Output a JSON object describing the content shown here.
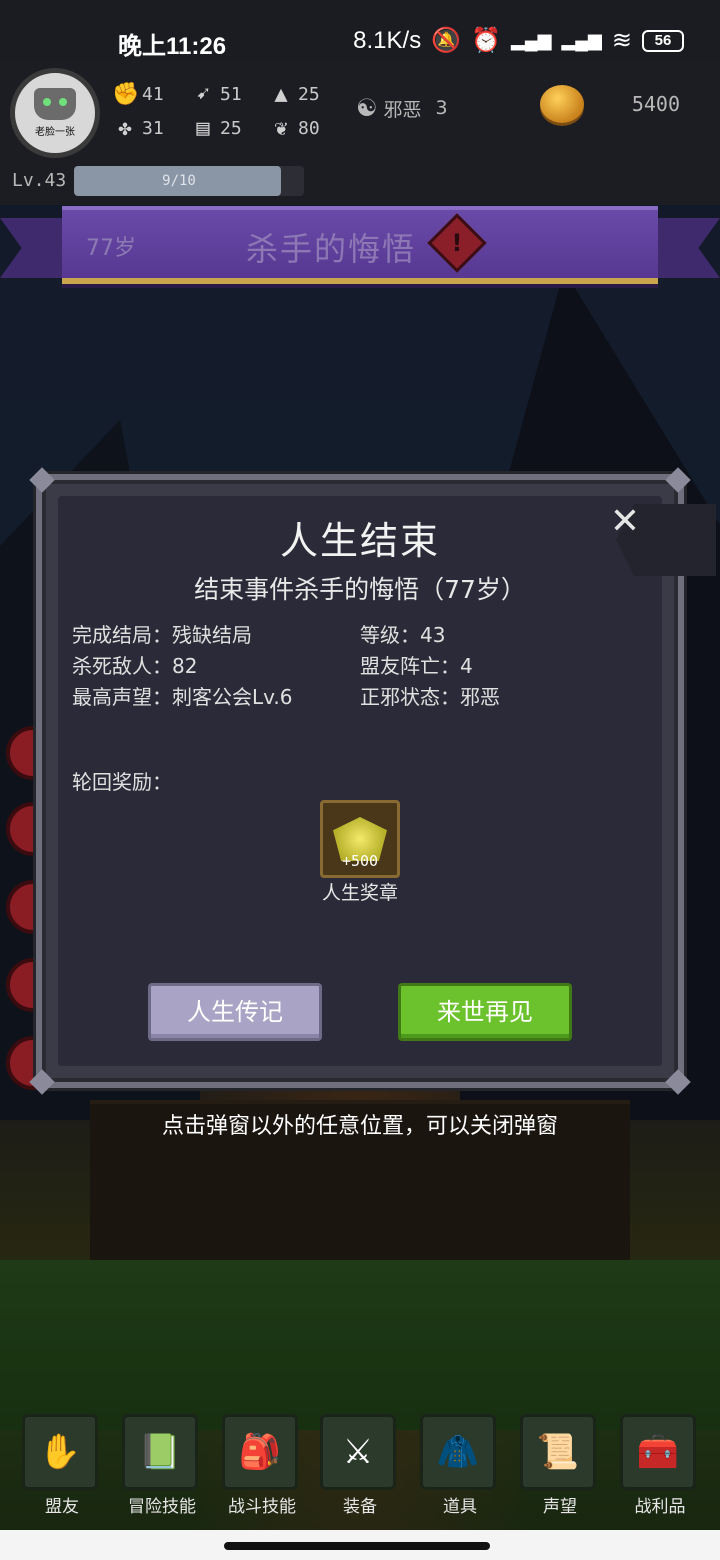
{
  "status_bar": {
    "time": "晚上11:26",
    "speed": "8.1K/s",
    "battery": "56"
  },
  "hud": {
    "avatar_name": "老脸一张",
    "stats": [
      {
        "icon": "fist-icon",
        "glyph": "✊",
        "value": "41"
      },
      {
        "icon": "clover-icon",
        "glyph": "✤",
        "value": "31"
      },
      {
        "icon": "gesture-icon",
        "glyph": "➹",
        "value": "51"
      },
      {
        "icon": "book-icon",
        "glyph": "▤",
        "value": "25"
      },
      {
        "icon": "wizard-hat-icon",
        "glyph": "▲",
        "value": "25"
      },
      {
        "icon": "lotus-icon",
        "glyph": "❦",
        "value": "80"
      }
    ],
    "alignment": {
      "icon": "yin-yang-icon",
      "glyph": "☯",
      "label": "邪恶",
      "value": "3"
    },
    "gold": "5400",
    "level": "Lv.43",
    "xp_text": "9/10",
    "xp_fraction": 0.9
  },
  "banner": {
    "age": "77岁",
    "title": "杀手的悔悟",
    "alert": "!"
  },
  "modal": {
    "title": "人生结束",
    "close": "✕",
    "event": "结束事件杀手的悔悟（77岁）",
    "info_left": [
      "完成结局：残缺结局",
      "杀死敌人：82",
      "最高声望：刺客公会Lv.6"
    ],
    "info_right": [
      "等级：43",
      "盟友阵亡：4",
      "正邪状态：邪恶"
    ],
    "reward_label": "轮回奖励：",
    "reward": {
      "count": "+500",
      "name": "人生奖章"
    },
    "btn_story": "人生传记",
    "btn_next": "来世再见"
  },
  "hint": "点击弹窗以外的任意位置，可以关闭弹窗",
  "bottom_nav": [
    {
      "label": "盟友",
      "glyph": "✋"
    },
    {
      "label": "冒险技能",
      "glyph": "📗"
    },
    {
      "label": "战斗技能",
      "glyph": "🎒"
    },
    {
      "label": "装备",
      "glyph": "⚔"
    },
    {
      "label": "道具",
      "glyph": "🧥"
    },
    {
      "label": "声望",
      "glyph": "📜"
    },
    {
      "label": "战利品",
      "glyph": "🧰"
    }
  ]
}
